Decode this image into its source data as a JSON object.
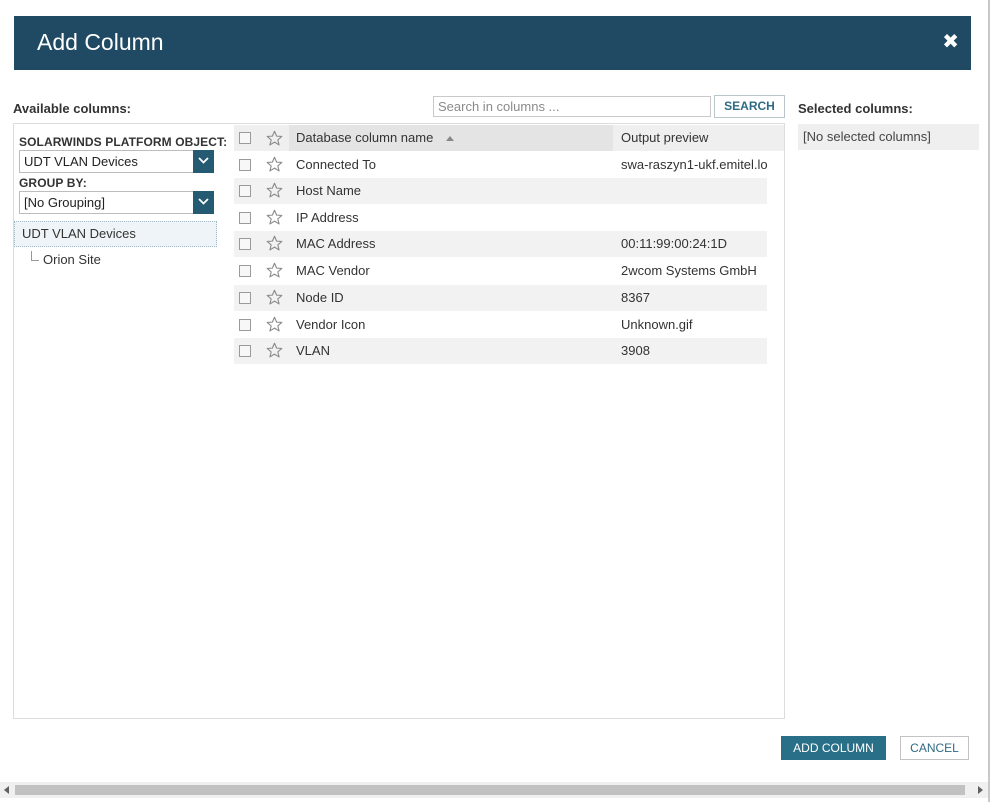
{
  "dialog": {
    "title": "Add Column",
    "close_glyph": "✖"
  },
  "available": {
    "label": "Available columns:",
    "object_label": "SOLARWINDS PLATFORM OBJECT:",
    "object_value": "UDT VLAN Devices",
    "group_label": "GROUP BY:",
    "group_value": "[No Grouping]",
    "tree": {
      "root": "UDT VLAN Devices",
      "children": [
        "Orion Site"
      ]
    }
  },
  "search": {
    "placeholder": "Search in columns ...",
    "button_label": "SEARCH"
  },
  "grid": {
    "columns": {
      "name": "Database column name",
      "preview": "Output preview"
    },
    "sort": "ascending",
    "rows": [
      {
        "name": "Connected To",
        "preview": "swa-raszyn1-ukf.emitel.lo"
      },
      {
        "name": "Host Name",
        "preview": ""
      },
      {
        "name": "IP Address",
        "preview": ""
      },
      {
        "name": "MAC Address",
        "preview": "00:11:99:00:24:1D"
      },
      {
        "name": "MAC Vendor",
        "preview": "2wcom Systems GmbH"
      },
      {
        "name": "Node ID",
        "preview": "8367"
      },
      {
        "name": "Vendor Icon",
        "preview": "Unknown.gif"
      },
      {
        "name": "VLAN",
        "preview": "3908"
      }
    ]
  },
  "selected": {
    "label": "Selected columns:",
    "empty_text": "[No selected columns]"
  },
  "footer": {
    "add_label": "ADD COLUMN",
    "cancel_label": "CANCEL"
  },
  "colors": {
    "header_bg": "#204a63",
    "primary_button": "#2a6f88",
    "dropdown_arrow_bg": "#245a72"
  },
  "icons": {
    "close": "close-icon",
    "dropdown": "chevron-down-icon",
    "star": "star-icon",
    "sort": "sort-ascending-icon"
  }
}
